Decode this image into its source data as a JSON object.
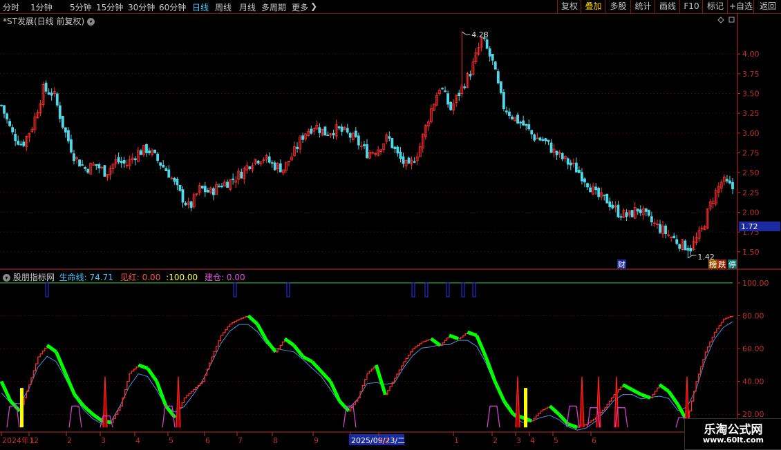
{
  "toolbar": {
    "timeframes": [
      "分时",
      "1分钟",
      "5分钟",
      "15分钟",
      "30分钟",
      "60分钟",
      "日线",
      "周线",
      "月线",
      "多周期",
      "更多"
    ],
    "active_timeframe": "日线",
    "more_arrow": "❯",
    "buttons": [
      "复权",
      "叠加",
      "多股",
      "统计",
      "画线",
      "F10",
      "标记",
      "+自选",
      "返回"
    ],
    "highlight_button": "叠加"
  },
  "price_panel": {
    "title": "*ST发展(日线 前复权)",
    "high_label": "4.28",
    "low_label": "1.42",
    "current_price": "1.72",
    "badges": [
      "财",
      "榜",
      "跌",
      "停"
    ]
  },
  "indicator_panel": {
    "name": "股朋指标网",
    "life_label": "生命线:",
    "life_value": "74.71",
    "red_label": "见红:",
    "red_value": "0.00",
    "sep_value": ":100.00",
    "build_label": "建仓:",
    "build_value": "0.00"
  },
  "date_axis": {
    "labels": [
      "2024年12",
      "1",
      "2",
      "3",
      "4",
      "5",
      "6",
      "7",
      "8",
      "9",
      "2025/09/23/二",
      "12",
      "1",
      "2",
      "3",
      "4",
      "5",
      "6"
    ],
    "highlight": "2025/09/23/二"
  },
  "watermark": {
    "main": "乐淘公式网",
    "sub": "www.60lt.com"
  },
  "colors": {
    "up": "#ff3030",
    "down": "#4fd8e8",
    "life": "#00ff00",
    "build": "#3030ff",
    "red": "#ff2020",
    "magenta": "#d040d0",
    "yellow": "#ffff00",
    "axis": "#c03030",
    "thin": "#4a90e0"
  },
  "chart_data": [
    {
      "type": "candlestick",
      "title": "*ST发展(日线 前复权)",
      "ylim": [
        1.35,
        4.35
      ],
      "y_ticks": [
        1.5,
        1.75,
        2.0,
        2.25,
        2.5,
        2.75,
        3.0,
        3.25,
        3.5,
        3.75,
        4.0
      ],
      "close_trend": [
        3.35,
        3.0,
        2.85,
        3.1,
        3.55,
        3.5,
        3.05,
        2.7,
        2.55,
        2.6,
        2.5,
        2.65,
        2.6,
        2.75,
        2.8,
        2.65,
        2.5,
        2.25,
        2.05,
        2.3,
        2.25,
        2.35,
        2.4,
        2.5,
        2.65,
        2.7,
        2.6,
        2.55,
        2.75,
        3.0,
        3.1,
        3.0,
        3.05,
        3.0,
        2.9,
        2.75,
        2.8,
        2.95,
        2.7,
        2.55,
        2.8,
        3.25,
        3.6,
        3.3,
        3.55,
        3.8,
        4.2,
        3.9,
        3.35,
        3.2,
        3.1,
        2.95,
        2.9,
        2.75,
        2.65,
        2.55,
        2.4,
        2.2,
        2.15,
        2.0,
        1.95,
        2.05,
        1.9,
        1.8,
        1.7,
        1.6,
        1.55,
        1.75,
        2.15,
        2.4,
        2.3
      ],
      "high": 4.28,
      "low": 1.42
    },
    {
      "type": "line",
      "title": "股朋指标网",
      "ylim": [
        10,
        105
      ],
      "y_ticks": [
        20.0,
        40.0,
        60.0,
        80.0,
        100.0
      ],
      "series": [
        {
          "name": "生命线",
          "values": [
            40,
            28,
            22,
            38,
            55,
            62,
            58,
            45,
            32,
            25,
            20,
            16,
            15,
            25,
            45,
            50,
            48,
            40,
            25,
            18,
            30,
            35,
            40,
            55,
            68,
            75,
            78,
            80,
            75,
            65,
            58,
            66,
            62,
            55,
            52,
            46,
            40,
            28,
            22,
            30,
            45,
            50,
            32,
            42,
            52,
            60,
            64,
            66,
            62,
            68,
            66,
            70,
            68,
            55,
            40,
            28,
            20,
            18,
            16,
            22,
            25,
            20,
            14,
            12,
            14,
            18,
            24,
            32,
            38,
            35,
            32,
            30,
            38,
            34,
            26,
            16,
            40,
            58,
            70,
            78,
            80
          ]
        }
      ]
    }
  ]
}
